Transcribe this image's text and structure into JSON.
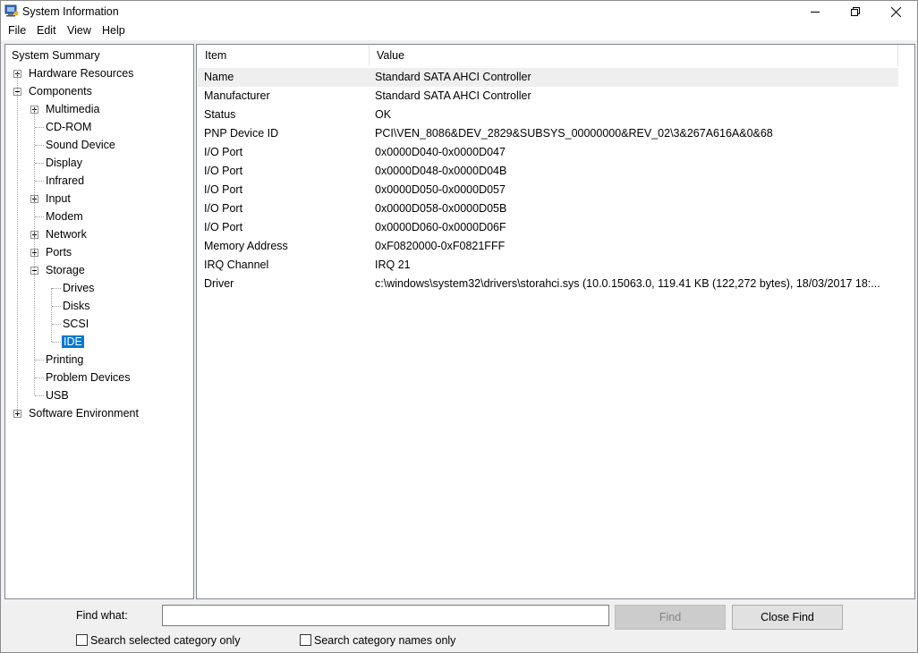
{
  "window": {
    "title": "System Information"
  },
  "menu": [
    "File",
    "Edit",
    "View",
    "Help"
  ],
  "tree": [
    {
      "label": "System Summary",
      "level": 0,
      "expander": "none"
    },
    {
      "label": "Hardware Resources",
      "level": 1,
      "expander": "plus"
    },
    {
      "label": "Components",
      "level": 1,
      "expander": "minus"
    },
    {
      "label": "Multimedia",
      "level": 2,
      "expander": "plus"
    },
    {
      "label": "CD-ROM",
      "level": 2,
      "expander": "none"
    },
    {
      "label": "Sound Device",
      "level": 2,
      "expander": "none"
    },
    {
      "label": "Display",
      "level": 2,
      "expander": "none"
    },
    {
      "label": "Infrared",
      "level": 2,
      "expander": "none"
    },
    {
      "label": "Input",
      "level": 2,
      "expander": "plus"
    },
    {
      "label": "Modem",
      "level": 2,
      "expander": "none"
    },
    {
      "label": "Network",
      "level": 2,
      "expander": "plus"
    },
    {
      "label": "Ports",
      "level": 2,
      "expander": "plus"
    },
    {
      "label": "Storage",
      "level": 2,
      "expander": "minus"
    },
    {
      "label": "Drives",
      "level": 3,
      "expander": "none"
    },
    {
      "label": "Disks",
      "level": 3,
      "expander": "none"
    },
    {
      "label": "SCSI",
      "level": 3,
      "expander": "none"
    },
    {
      "label": "IDE",
      "level": 3,
      "expander": "none",
      "selected": true
    },
    {
      "label": "Printing",
      "level": 2,
      "expander": "none"
    },
    {
      "label": "Problem Devices",
      "level": 2,
      "expander": "none"
    },
    {
      "label": "USB",
      "level": 2,
      "expander": "none"
    },
    {
      "label": "Software Environment",
      "level": 1,
      "expander": "plus"
    }
  ],
  "table": {
    "columns": [
      "Item",
      "Value"
    ],
    "rows": [
      [
        "Name",
        "Standard SATA AHCI Controller"
      ],
      [
        "Manufacturer",
        "Standard SATA AHCI Controller"
      ],
      [
        "Status",
        "OK"
      ],
      [
        "PNP Device ID",
        "PCI\\VEN_8086&DEV_2829&SUBSYS_00000000&REV_02\\3&267A616A&0&68"
      ],
      [
        "I/O Port",
        "0x0000D040-0x0000D047"
      ],
      [
        "I/O Port",
        "0x0000D048-0x0000D04B"
      ],
      [
        "I/O Port",
        "0x0000D050-0x0000D057"
      ],
      [
        "I/O Port",
        "0x0000D058-0x0000D05B"
      ],
      [
        "I/O Port",
        "0x0000D060-0x0000D06F"
      ],
      [
        "Memory Address",
        "0xF0820000-0xF0821FFF"
      ],
      [
        "IRQ Channel",
        "IRQ 21"
      ],
      [
        "Driver",
        "c:\\windows\\system32\\drivers\\storahci.sys (10.0.15063.0, 119.41 KB (122,272 bytes), 18/03/2017 18:..."
      ]
    ]
  },
  "find": {
    "label": "Find what:",
    "value": "",
    "find_button": "Find",
    "close_button": "Close Find",
    "search_selected": "Search selected category only",
    "search_names": "Search category names only"
  },
  "colors": {
    "selection": "#0078d7"
  }
}
